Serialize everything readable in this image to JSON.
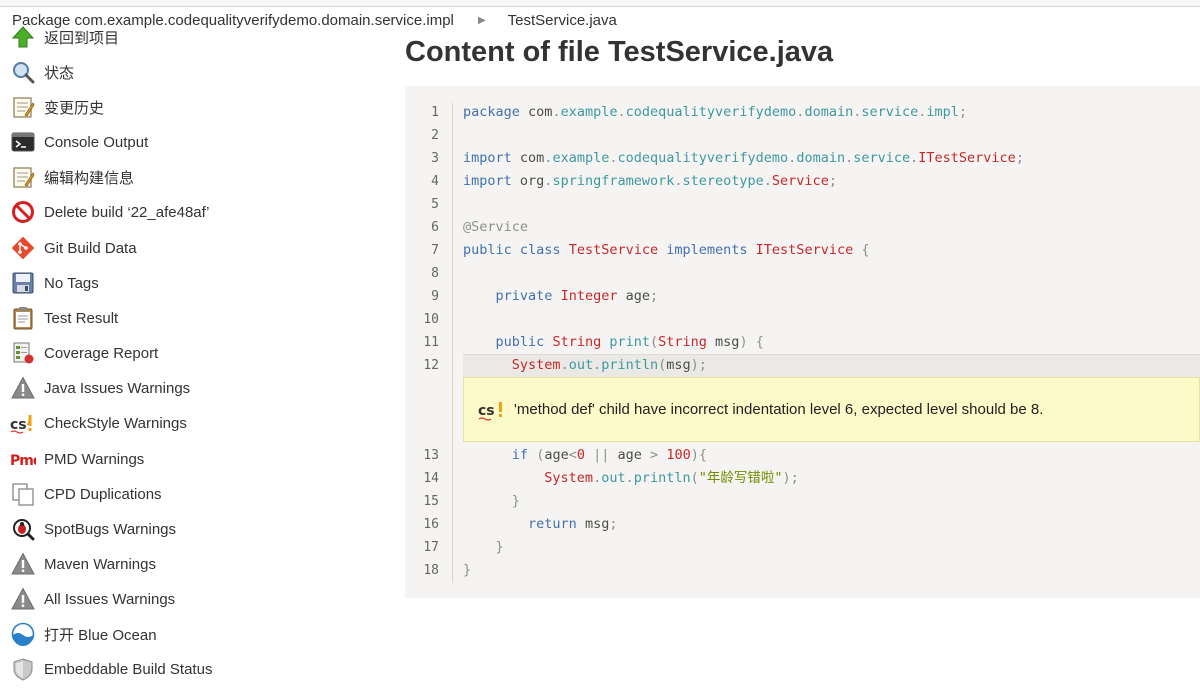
{
  "breadcrumb": {
    "package": "Package com.example.codequalityverifydemo.domain.service.impl",
    "file": "TestService.java"
  },
  "page_title": "Content of file TestService.java",
  "sidebar": {
    "items": [
      {
        "label": "返回到项目",
        "icon": "up-arrow-icon"
      },
      {
        "label": "状态",
        "icon": "search-icon"
      },
      {
        "label": "变更历史",
        "icon": "notepad-icon"
      },
      {
        "label": "Console Output",
        "icon": "terminal-icon"
      },
      {
        "label": "编辑构建信息",
        "icon": "notepad-icon"
      },
      {
        "label": "Delete build ‘22_afe48af’",
        "icon": "no-entry-icon"
      },
      {
        "label": "Git Build Data",
        "icon": "git-icon"
      },
      {
        "label": "No Tags",
        "icon": "save-icon"
      },
      {
        "label": "Test Result",
        "icon": "clipboard-icon"
      },
      {
        "label": "Coverage Report",
        "icon": "coverage-icon"
      },
      {
        "label": "Java Issues Warnings",
        "icon": "warning-icon"
      },
      {
        "label": "CheckStyle Warnings",
        "icon": "checkstyle-icon"
      },
      {
        "label": "PMD Warnings",
        "icon": "pmd-icon"
      },
      {
        "label": "CPD Duplications",
        "icon": "duplicate-icon"
      },
      {
        "label": "SpotBugs Warnings",
        "icon": "spotbugs-icon"
      },
      {
        "label": "Maven Warnings",
        "icon": "warning-icon"
      },
      {
        "label": "All Issues Warnings",
        "icon": "warning-icon"
      },
      {
        "label": "打开 Blue Ocean",
        "icon": "blue-ocean-icon"
      },
      {
        "label": "Embeddable Build Status",
        "icon": "shield-icon"
      }
    ]
  },
  "code": {
    "lines": [
      {
        "n": "1",
        "text": "package com.example.codequalityverifydemo.domain.service.impl;"
      },
      {
        "n": "2",
        "text": ""
      },
      {
        "n": "3",
        "text": "import com.example.codequalityverifydemo.domain.service.ITestService;"
      },
      {
        "n": "4",
        "text": "import org.springframework.stereotype.Service;"
      },
      {
        "n": "5",
        "text": ""
      },
      {
        "n": "6",
        "text": "@Service"
      },
      {
        "n": "7",
        "text": "public class TestService implements ITestService {"
      },
      {
        "n": "8",
        "text": ""
      },
      {
        "n": "9",
        "text": "    private Integer age;"
      },
      {
        "n": "10",
        "text": ""
      },
      {
        "n": "11",
        "text": "    public String print(String msg) {"
      },
      {
        "n": "12",
        "text": "      System.out.println(msg);"
      },
      {
        "n": "13",
        "text": "      if (age<0 || age > 100){"
      },
      {
        "n": "14",
        "text": "          System.out.println(\"年龄写错啦\");"
      },
      {
        "n": "15",
        "text": "      }"
      },
      {
        "n": "16",
        "text": "        return msg;"
      },
      {
        "n": "17",
        "text": "    }"
      },
      {
        "n": "18",
        "text": "}"
      }
    ],
    "highlighted_line": "12"
  },
  "warning": {
    "icon": "checkstyle-icon",
    "message": "'method def' child have incorrect indentation level 6, expected level should be 8."
  },
  "colors": {
    "keyword": "#4271ae",
    "type": "#c82829",
    "package": "#3e999f",
    "annotation": "#8e908c",
    "string": "#718c00",
    "warning_bg": "#fcfac8",
    "code_bg": "#f5f4f2"
  }
}
